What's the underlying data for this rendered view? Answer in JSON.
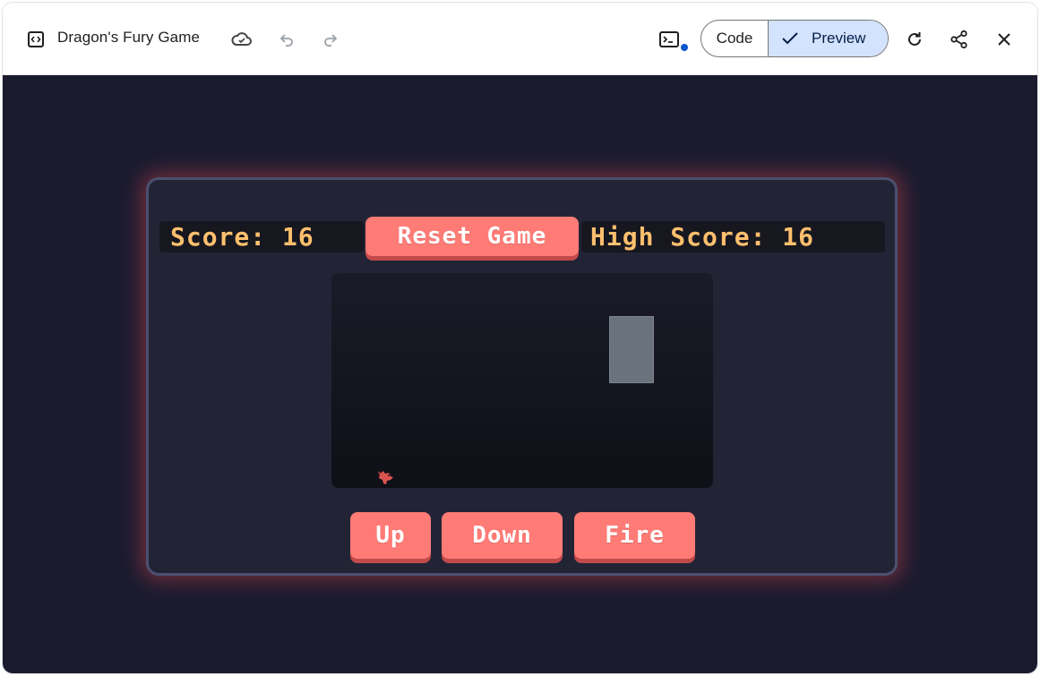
{
  "topbar": {
    "title": "Dragon's Fury Game",
    "code_label": "Code",
    "preview_label": "Preview",
    "icons": [
      "code-file-icon",
      "cloud-icon",
      "undo-icon",
      "redo-icon",
      "terminal-icon",
      "refresh-icon",
      "share-icon",
      "close-icon"
    ]
  },
  "game": {
    "score_text": "Score: 16",
    "reset_label": "Reset Game",
    "high_score_text": "High Score: 16",
    "controls": {
      "up": "Up",
      "down": "Down",
      "fire": "Fire"
    }
  },
  "colors": {
    "stage_bg": "#1b1b2f",
    "panel_bg": "#222436",
    "accent_button": "#ff7b76",
    "score_text": "#ffc06e",
    "preview_active": "#d3e3fd"
  }
}
